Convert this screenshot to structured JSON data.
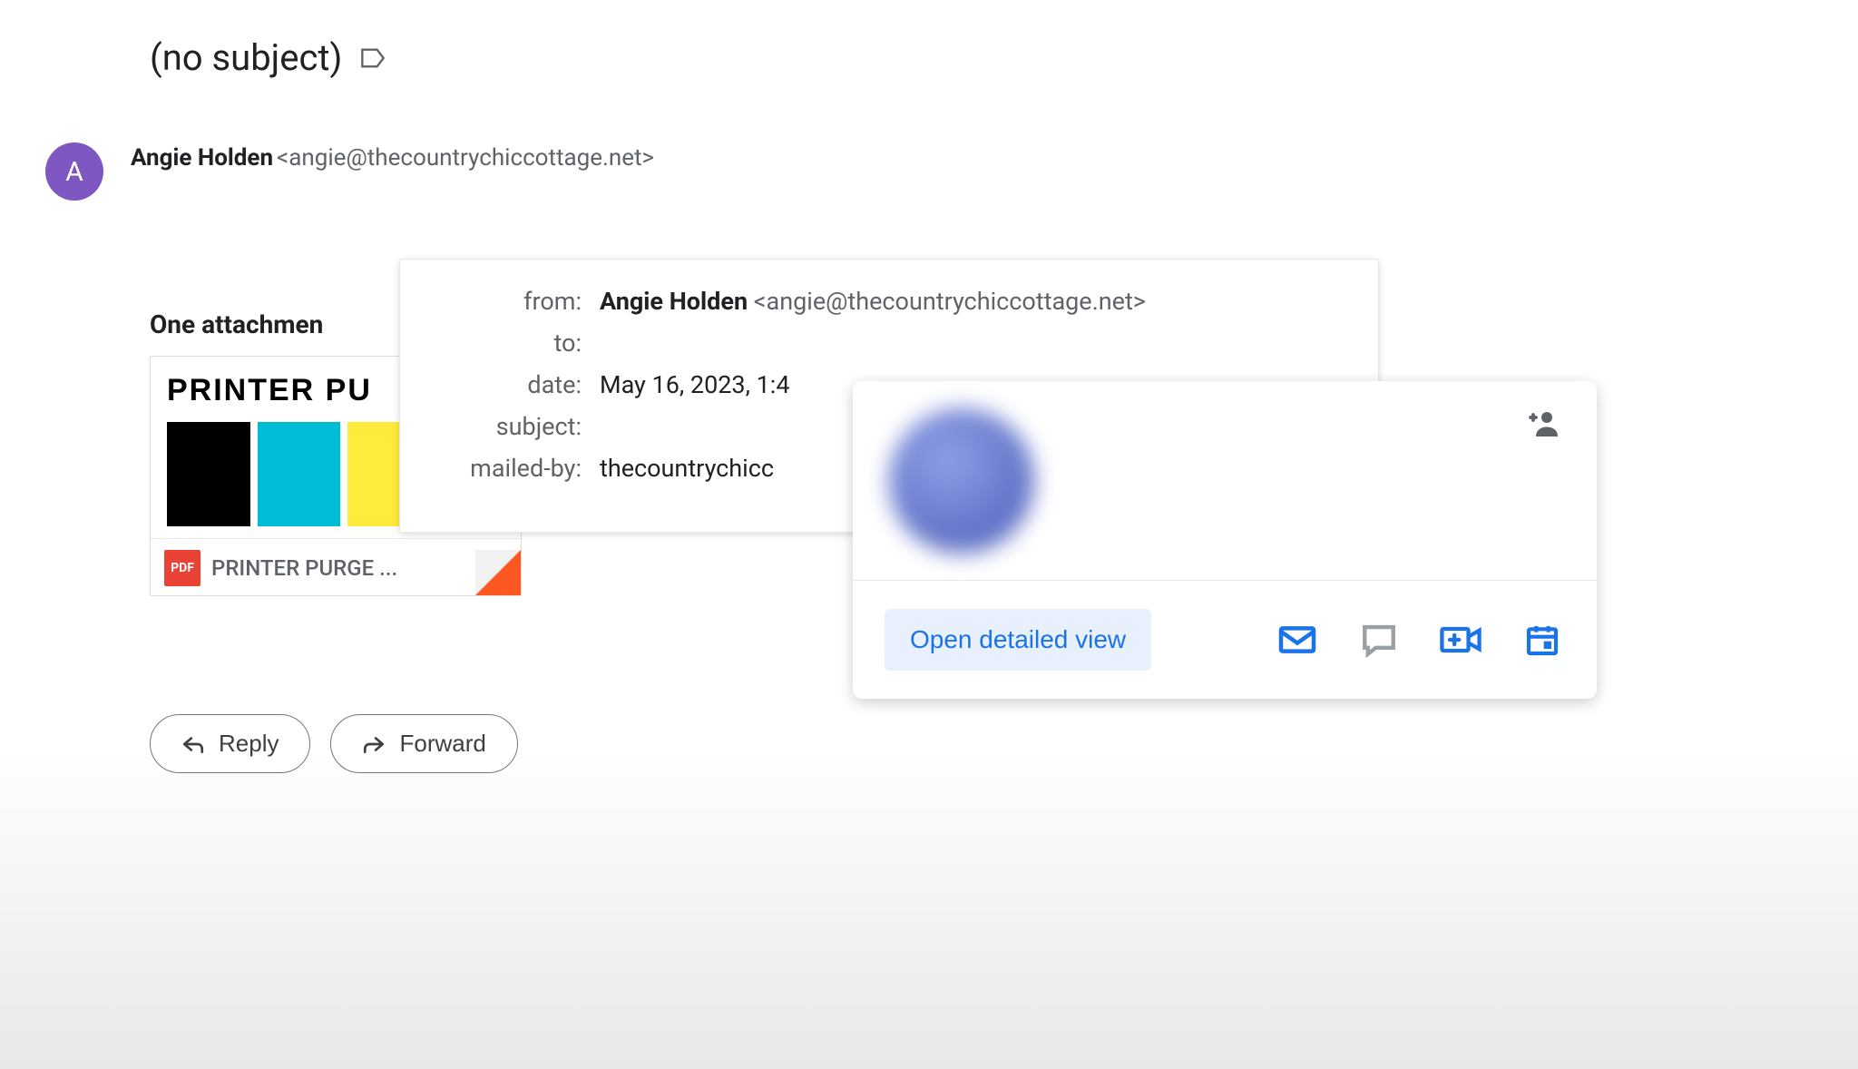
{
  "subject": "(no subject)",
  "sender": {
    "avatar_letter": "A",
    "name": "Angie Holden",
    "email": "<angie@thecountrychiccottage.net>"
  },
  "attachments": {
    "section_label": "One attachmen",
    "preview_title": "PRINTER PU",
    "pdf_badge": "PDF",
    "filename": "PRINTER PURGE ..."
  },
  "details": {
    "fields": {
      "from_label": "from:",
      "to_label": "to:",
      "date_label": "date:",
      "subject_label": "subject:",
      "mailed_by_label": "mailed-by:"
    },
    "from_name": "Angie Holden",
    "from_email": "<angie@thecountrychiccottage.net>",
    "date_value": "May 16, 2023, 1:4",
    "mailed_by_value": "thecountrychicc"
  },
  "contact_card": {
    "open_detailed": "Open detailed view"
  },
  "actions": {
    "reply": "Reply",
    "forward": "Forward"
  }
}
